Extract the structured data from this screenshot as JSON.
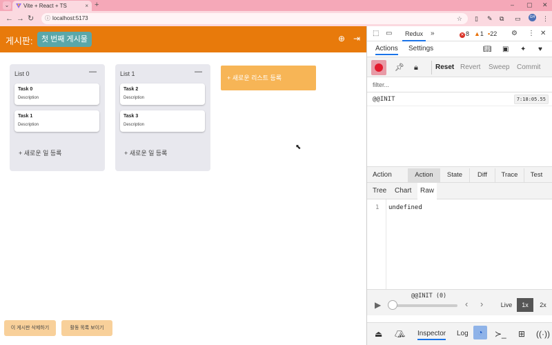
{
  "browser": {
    "tab_title": "Vite + React + TS",
    "tab_close": "×",
    "new_tab": "+",
    "url": "localhost:5173",
    "profile_initials": "GH",
    "window_controls": {
      "minimize": "–",
      "maximize": "▢",
      "close": "✕"
    }
  },
  "app": {
    "title": "게시판:",
    "board_name": "첫 번째 게시물",
    "lists": [
      {
        "title": "List 0",
        "cards": [
          {
            "title": "Task 0",
            "description": "Description"
          },
          {
            "title": "Task 1",
            "description": "Description"
          }
        ],
        "add_task": "+ 새로운 일 등록"
      },
      {
        "title": "List 1",
        "cards": [
          {
            "title": "Task 2",
            "description": "Description"
          },
          {
            "title": "Task 3",
            "description": "Description"
          }
        ],
        "add_task": "+ 새로운 일 등록"
      }
    ],
    "add_list": "+ 새로운 리스트 등록",
    "delete_board": "이 게시판 삭제하기",
    "show_activity": "활동 목록 보이기"
  },
  "devtools": {
    "panel": "Redux",
    "errors": "8",
    "warnings": "1",
    "issues": "22",
    "tabs": {
      "actions": "Actions",
      "settings": "Settings"
    },
    "action_buttons": {
      "reset": "Reset",
      "revert": "Revert",
      "sweep": "Sweep",
      "commit": "Commit"
    },
    "filter_placeholder": "filter...",
    "actions_list": [
      {
        "name": "@@INIT",
        "time": "7:18:05.55"
      }
    ],
    "inspector": {
      "label": "Action",
      "tabs": [
        "Action",
        "State",
        "Diff",
        "Trace",
        "Test"
      ],
      "active_tab": "Action",
      "sub_tabs": [
        "Tree",
        "Chart",
        "Raw"
      ],
      "active_sub_tab": "Raw",
      "line_number": "1",
      "value": "undefined"
    },
    "slider": {
      "label": "@@INIT (0)",
      "live": "Live",
      "speed_1x": "1x",
      "speed_2x": "2x"
    },
    "bottom": {
      "inspector": "Inspector",
      "log": "Log"
    }
  },
  "colors": {
    "app_header": "#e87a0b",
    "board_badge": "#5aa7a9",
    "add_list": "#f7b556",
    "bottom_buttons": "#f8d09a",
    "tabstrip": "#f5a8b8"
  }
}
